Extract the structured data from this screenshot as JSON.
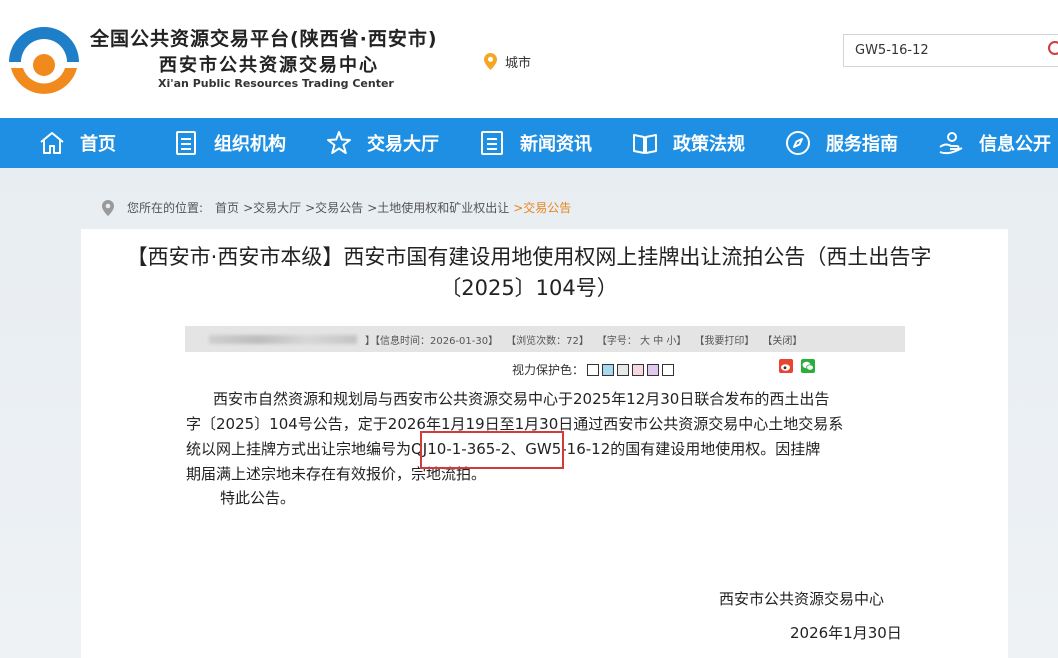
{
  "header": {
    "title_cn1": "全国公共资源交易平台(陕西省·西安市)",
    "title_cn2": "西安市公共资源交易中心",
    "title_en": "Xi'an Public Resources Trading Center",
    "city_label": "城市",
    "search_value": "GW5-16-12",
    "logo_colors": {
      "blue": "#1e7fc8",
      "orange": "#f08a1c"
    }
  },
  "nav": {
    "items": [
      {
        "label": "首页",
        "icon": "home-icon"
      },
      {
        "label": "组织机构",
        "icon": "document-icon"
      },
      {
        "label": "交易大厅",
        "icon": "star-icon"
      },
      {
        "label": "新闻资讯",
        "icon": "list-icon"
      },
      {
        "label": "政策法规",
        "icon": "book-icon"
      },
      {
        "label": "服务指南",
        "icon": "compass-icon"
      },
      {
        "label": "信息公开",
        "icon": "hand-icon"
      }
    ],
    "bg_color": "#1e8fe3"
  },
  "breadcrumb": {
    "prefix": "您所在的位置:",
    "items": [
      "首页",
      ">交易大厅",
      ">交易公告",
      ">土地使用权和矿业权出让",
      ">交易公告"
    ]
  },
  "article": {
    "title_line1": "【西安市·西安市本级】西安市国有建设用地使用权网上挂牌出让流拍公告（西土出告字",
    "title_line2": "〔2025〕104号）",
    "meta": {
      "info_time": "】【信息时间：2026-01-30】",
      "views": "【浏览次数：72】",
      "font_size": "【字号： 大  中  小】",
      "print": "【我要打印】",
      "close": "【关闭】"
    },
    "eye_label": "视力保护色：",
    "eye_colors": [
      "#ffffff",
      "#a8d8f0",
      "#e8e8e8",
      "#f8d8e0",
      "#e0c8f0",
      "#ffffff"
    ],
    "body_lines": [
      "西安市自然资源和规划局与西安市公共资源交易中心于2025年12月30日联合发布的西土出告",
      "字〔2025〕104号公告，定于2026年1月19日至1月30日通过西安市公共资源交易中心土地交易系",
      "统以网上挂牌方式出让宗地编号为QJ10-1-365-2、GW5-16-12的国有建设用地使用权。因挂牌",
      "期届满上述宗地未存在有效报价，宗地流拍。"
    ],
    "closing": "特此公告。",
    "org": "西安市公共资源交易中心",
    "date": "2026年1月30日"
  }
}
